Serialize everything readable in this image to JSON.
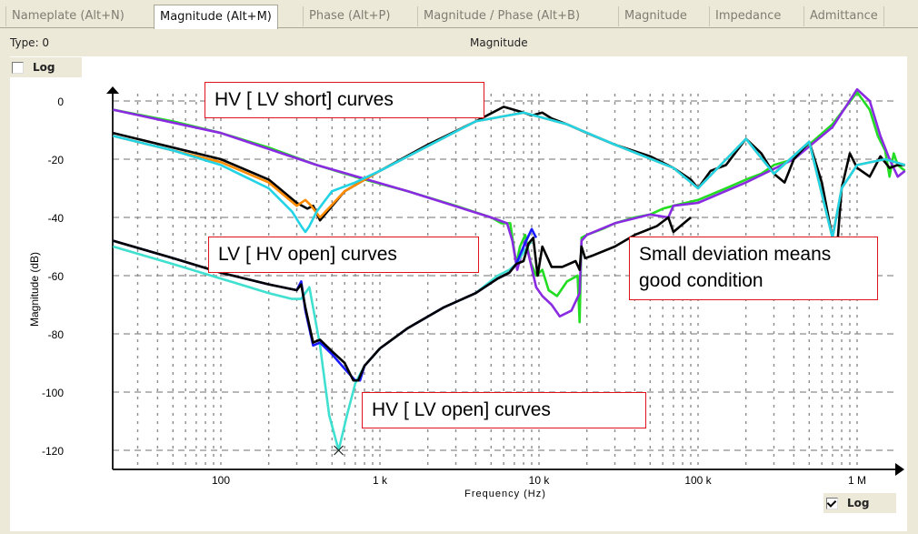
{
  "tabs": [
    {
      "label": "Nameplate (Alt+N)",
      "active": false
    },
    {
      "label": "Magnitude (Alt+M)",
      "active": true
    },
    {
      "label": "Phase (Alt+P)",
      "active": false
    },
    {
      "label": "Magnitude / Phase (Alt+B)",
      "active": false
    },
    {
      "label": "Magnitude",
      "active": false
    },
    {
      "label": "Impedance",
      "active": false
    },
    {
      "label": "Admittance",
      "active": false
    }
  ],
  "type_label": "Type: 0",
  "panel_title": "Magnitude",
  "y_log": {
    "label": "Log",
    "checked": false
  },
  "x_log": {
    "label": "Log",
    "checked": true
  },
  "annotations": {
    "hv_lv_short": "HV [ LV short] curves",
    "lv_hv_open": "LV [ HV open] curves",
    "hv_lv_open": "HV [ LV open] curves",
    "small_deviation": "Small deviation means good condition"
  },
  "chart_data": {
    "type": "line",
    "title": "Magnitude",
    "xlabel": "Frequency (Hz)",
    "ylabel": "Magnitude (dB)",
    "xscale": "log",
    "xlim": [
      20,
      2000000
    ],
    "ylim": [
      -125,
      5
    ],
    "grid": true,
    "x_ticks": [
      {
        "value": 100,
        "label": "100"
      },
      {
        "value": 1000,
        "label": "1 k"
      },
      {
        "value": 10000,
        "label": "10 k"
      },
      {
        "value": 100000,
        "label": "100 k"
      },
      {
        "value": 1000000,
        "label": "1 M"
      }
    ],
    "y_ticks": [
      {
        "value": 0,
        "label": "0"
      },
      {
        "value": -20,
        "label": "-20"
      },
      {
        "value": -40,
        "label": "-40"
      },
      {
        "value": -60,
        "label": "-60"
      },
      {
        "value": -80,
        "label": "-80"
      },
      {
        "value": -100,
        "label": "-100"
      },
      {
        "value": -120,
        "label": "-120"
      }
    ],
    "marker": {
      "x": 550,
      "y": -120,
      "symbol": "x"
    },
    "series": [
      {
        "name": "HV [LV short] green",
        "color": "#22dd22",
        "x": [
          21,
          50,
          100,
          200,
          400,
          800,
          1500,
          3000,
          5000,
          5800,
          6300,
          6600,
          7200,
          7600,
          8200,
          8800,
          9600,
          10500,
          11500,
          13000,
          15000,
          17500,
          18000,
          18500,
          20000,
          25000,
          30000,
          40000,
          50000,
          60000,
          70000,
          100000,
          150000,
          200000,
          250000,
          300000,
          400000,
          500000,
          700000,
          1000000,
          1200000,
          1350000,
          1500000,
          1600000,
          1700000,
          1800000,
          2000000
        ],
        "y": [
          -3,
          -7,
          -11,
          -16,
          -22,
          -27,
          -31,
          -36,
          -40,
          -42,
          -42,
          -42,
          -56,
          -50,
          -46,
          -55,
          -60,
          -58,
          -65,
          -67,
          -62,
          -60,
          -76,
          -47,
          -46,
          -44,
          -42,
          -40,
          -39,
          -37,
          -36,
          -34,
          -30,
          -27,
          -25,
          -22,
          -20,
          -15,
          -8,
          3,
          -3,
          -12,
          -17,
          -26,
          -18,
          -22,
          -24
        ]
      },
      {
        "name": "HV [LV short] purple",
        "color": "#8a2be2",
        "x": [
          21,
          100,
          400,
          1500,
          5000,
          6300,
          6800,
          7300,
          8200,
          8800,
          9600,
          10500,
          12000,
          13500,
          16000,
          18000,
          18500,
          20000,
          30000,
          50000,
          65000,
          70000,
          100000,
          200000,
          400000,
          700000,
          1000000,
          1200000,
          1400000,
          1600000,
          1800000,
          2000000
        ],
        "y": [
          -3,
          -11,
          -22,
          -31,
          -40,
          -42,
          -48,
          -58,
          -48,
          -55,
          -64,
          -67,
          -70,
          -74,
          -72,
          -66,
          -48,
          -46,
          -42,
          -39,
          -40,
          -36,
          -35,
          -28,
          -20,
          -9,
          4,
          0,
          -12,
          -20,
          -26,
          -24
        ]
      },
      {
        "name": "HV [LV open] black",
        "color": "#000000",
        "x": [
          21,
          50,
          100,
          200,
          300,
          350,
          380,
          420,
          600,
          1000,
          2000,
          4000,
          6000,
          8000,
          9000,
          10500,
          12000,
          15000,
          20000,
          30000,
          50000,
          70000,
          90000,
          100000,
          120000,
          150000,
          200000,
          250000,
          300000,
          350000,
          400000,
          500000,
          600000,
          700000,
          750000,
          800000,
          900000,
          1000000,
          1200000,
          1400000,
          1600000,
          1800000,
          2000000
        ],
        "y": [
          -11,
          -16,
          -20,
          -27,
          -35,
          -37,
          -36,
          -41,
          -31,
          -24,
          -15,
          -7,
          -2,
          -4,
          -5,
          -4,
          -6,
          -8,
          -11,
          -15,
          -19,
          -23,
          -27,
          -30,
          -24,
          -22,
          -13,
          -18,
          -25,
          -28,
          -20,
          -14,
          -28,
          -47,
          -50,
          -30,
          -18,
          -23,
          -26,
          -19,
          -23,
          -22,
          -22
        ]
      },
      {
        "name": "HV [LV open] orange",
        "color": "#ff8c00",
        "x": [
          21,
          100,
          200,
          300,
          340,
          370,
          420,
          600,
          1000,
          4000,
          8000,
          15000,
          30000,
          70000,
          100000,
          200000,
          300000,
          500000,
          700000,
          800000,
          1000000,
          1500000,
          2000000
        ],
        "y": [
          -12,
          -21,
          -28,
          -36,
          -34,
          -36,
          -40,
          -31,
          -24,
          -7,
          -4,
          -8,
          -15,
          -23,
          -30,
          -13,
          -25,
          -14,
          -47,
          -30,
          -22,
          -20,
          -22
        ]
      },
      {
        "name": "HV [LV open] cyan",
        "color": "#22d3e6",
        "x": [
          21,
          50,
          100,
          200,
          280,
          320,
          340,
          360,
          400,
          500,
          700,
          1000,
          4000,
          8000,
          15000,
          30000,
          70000,
          100000,
          200000,
          300000,
          500000,
          700000,
          800000,
          1000000,
          1500000,
          2000000
        ],
        "y": [
          -12,
          -17,
          -22,
          -30,
          -38,
          -43,
          -45,
          -43,
          -38,
          -31,
          -28,
          -24,
          -7,
          -4,
          -8,
          -15,
          -23,
          -30,
          -13,
          -25,
          -14,
          -47,
          -30,
          -22,
          -20,
          -22
        ]
      },
      {
        "name": "LV [HV open] cyan",
        "color": "#40e0d0",
        "x": [
          21,
          50,
          100,
          200,
          280,
          320,
          360,
          420,
          480,
          550,
          620,
          700,
          800,
          1000,
          1500,
          2500,
          4000,
          5500,
          6500,
          7200,
          8000,
          9000
        ],
        "y": [
          -50,
          -56,
          -61,
          -66,
          -68,
          -68,
          -64,
          -84,
          -108,
          -120,
          -108,
          -97,
          -91,
          -85,
          -78,
          -71,
          -66,
          -60,
          -58,
          -56,
          -52,
          -48
        ]
      },
      {
        "name": "LV [HV open] blue",
        "color": "#1a1aff",
        "x": [
          21,
          50,
          100,
          200,
          300,
          320,
          340,
          380,
          420,
          500,
          600,
          700,
          750,
          800,
          1000,
          1500,
          2500,
          4000,
          5500,
          6500,
          7200,
          8000,
          9000,
          9600
        ],
        "y": [
          -48,
          -54,
          -59,
          -63,
          -65,
          -62,
          -72,
          -84,
          -83,
          -87,
          -92,
          -96,
          -96,
          -91,
          -85,
          -78,
          -71,
          -66,
          -61,
          -59,
          -56,
          -50,
          -44,
          -47
        ]
      },
      {
        "name": "LV [HV open] black",
        "color": "#000000",
        "x": [
          21,
          50,
          100,
          200,
          300,
          320,
          340,
          380,
          420,
          500,
          600,
          680,
          730,
          800,
          1000,
          1500,
          2500,
          4000,
          5500,
          6500,
          7200,
          8000,
          8600,
          9200,
          9800,
          10500,
          12000,
          14000,
          17000,
          18000,
          18500,
          19500,
          22000,
          30000,
          40000,
          55000,
          65000,
          70000,
          90000
        ],
        "y": [
          -48,
          -54,
          -59,
          -63,
          -65,
          -63,
          -71,
          -83,
          -82,
          -86,
          -90,
          -96,
          -96,
          -91,
          -85,
          -78,
          -71,
          -66,
          -61,
          -59,
          -56,
          -55,
          -49,
          -47,
          -60,
          -50,
          -57,
          -57,
          -55,
          -58,
          -50,
          -54,
          -53,
          -50,
          -46,
          -43,
          -40,
          -45,
          -40
        ]
      }
    ]
  }
}
